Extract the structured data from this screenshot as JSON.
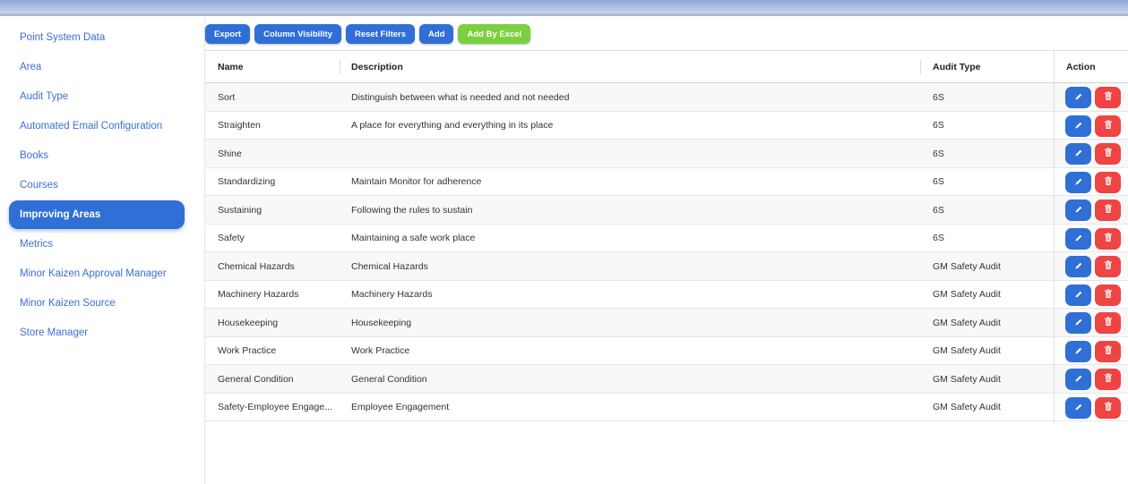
{
  "sidebar": {
    "items": [
      {
        "label": "Point System Data",
        "active": false
      },
      {
        "label": "Area",
        "active": false
      },
      {
        "label": "Audit Type",
        "active": false
      },
      {
        "label": "Automated Email Configuration",
        "active": false
      },
      {
        "label": "Books",
        "active": false
      },
      {
        "label": "Courses",
        "active": false
      },
      {
        "label": "Improving Areas",
        "active": true
      },
      {
        "label": "Metrics",
        "active": false
      },
      {
        "label": "Minor Kaizen Approval Manager",
        "active": false
      },
      {
        "label": "Minor Kaizen Source",
        "active": false
      },
      {
        "label": "Store Manager",
        "active": false
      }
    ]
  },
  "toolbar": {
    "export_label": "Export",
    "column_visibility_label": "Column Visibility",
    "reset_filters_label": "Reset Filters",
    "add_label": "Add",
    "add_by_excel_label": "Add By Excel"
  },
  "table": {
    "headers": {
      "name": "Name",
      "description": "Description",
      "audit_type": "Audit Type",
      "action": "Action"
    },
    "rows": [
      {
        "name": "Sort",
        "description": "Distinguish between what is needed and not needed",
        "audit_type": "6S"
      },
      {
        "name": "Straighten",
        "description": "A place for everything and everything in its place",
        "audit_type": "6S"
      },
      {
        "name": "Shine",
        "description": "",
        "audit_type": "6S"
      },
      {
        "name": "Standardizing",
        "description": "Maintain Monitor for adherence",
        "audit_type": "6S"
      },
      {
        "name": "Sustaining",
        "description": "Following the rules to sustain",
        "audit_type": "6S"
      },
      {
        "name": "Safety",
        "description": "Maintaining a safe work place",
        "audit_type": "6S"
      },
      {
        "name": "Chemical Hazards",
        "description": "Chemical Hazards",
        "audit_type": "GM Safety Audit"
      },
      {
        "name": "Machinery Hazards",
        "description": "Machinery Hazards",
        "audit_type": "GM Safety Audit"
      },
      {
        "name": "Housekeeping",
        "description": "Housekeeping",
        "audit_type": "GM Safety Audit"
      },
      {
        "name": "Work Practice",
        "description": "Work Practice",
        "audit_type": "GM Safety Audit"
      },
      {
        "name": "General Condition",
        "description": "General Condition",
        "audit_type": "GM Safety Audit"
      },
      {
        "name": "Safety-Employee Engage...",
        "description": "Employee Engagement",
        "audit_type": "GM Safety Audit"
      }
    ],
    "row_actions": {
      "edit_icon": "pencil-icon",
      "delete_icon": "trash-icon"
    }
  },
  "colors": {
    "primary": "#2f6fd6",
    "success": "#7ccf3f",
    "danger": "#ef4444",
    "link": "#3b6fd1"
  }
}
